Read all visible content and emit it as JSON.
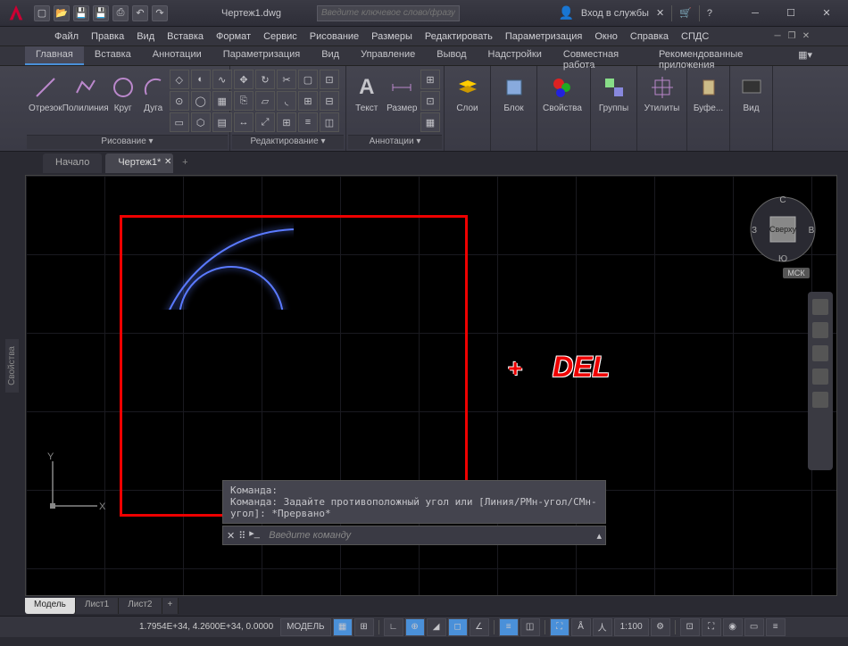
{
  "title": "Чертеж1.dwg",
  "search_placeholder": "Введите ключевое слово/фразу",
  "signin": "Вход в службы",
  "menubar": [
    "Файл",
    "Правка",
    "Вид",
    "Вставка",
    "Формат",
    "Сервис",
    "Рисование",
    "Размеры",
    "Редактировать",
    "Параметризация",
    "Окно",
    "Справка",
    "СПДС"
  ],
  "ribbon_tabs": [
    "Главная",
    "Вставка",
    "Аннотации",
    "Параметризация",
    "Вид",
    "Управление",
    "Вывод",
    "Надстройки",
    "Совместная работа",
    "Рекомендованные приложения"
  ],
  "panels": {
    "draw": {
      "title": "Рисование ▾",
      "items": [
        "Отрезок",
        "Полилиния",
        "Круг",
        "Дуга"
      ]
    },
    "edit": {
      "title": "Редактирование ▾"
    },
    "annot": {
      "title": "Аннотации ▾",
      "items": [
        "Текст",
        "Размер"
      ]
    },
    "layers": {
      "title": "",
      "label": "Слои"
    },
    "block": {
      "title": "",
      "label": "Блок"
    },
    "props": {
      "title": "",
      "label": "Свойства"
    },
    "groups": {
      "title": "",
      "label": "Группы"
    },
    "utils": {
      "title": "",
      "label": "Утилиты"
    },
    "clip": {
      "title": "",
      "label": "Буфе..."
    },
    "view": {
      "title": "",
      "label": "Вид"
    }
  },
  "filetabs": {
    "start": "Начало",
    "doc": "Чертеж1*"
  },
  "viewcube": {
    "top": "Сверху",
    "n": "С",
    "e": "В",
    "s": "Ю",
    "w": "З",
    "wcs": "МСК"
  },
  "cmd": {
    "hist1": "Команда:",
    "hist2": "Команда: Задайте противоположный угол или [Линия/РМн-угол/СМн-угол]: *Прервано*",
    "prompt": "Введите команду"
  },
  "layouttabs": [
    "Модель",
    "Лист1",
    "Лист2"
  ],
  "status": {
    "coords": "1.7954E+34, 4.2600E+34, 0.0000",
    "model": "МОДЕЛЬ",
    "scale": "1:100"
  },
  "side_panel": "Свойства",
  "annotation": {
    "plus": "+",
    "del": "DEL"
  },
  "ucs": {
    "x": "X",
    "y": "Y"
  }
}
